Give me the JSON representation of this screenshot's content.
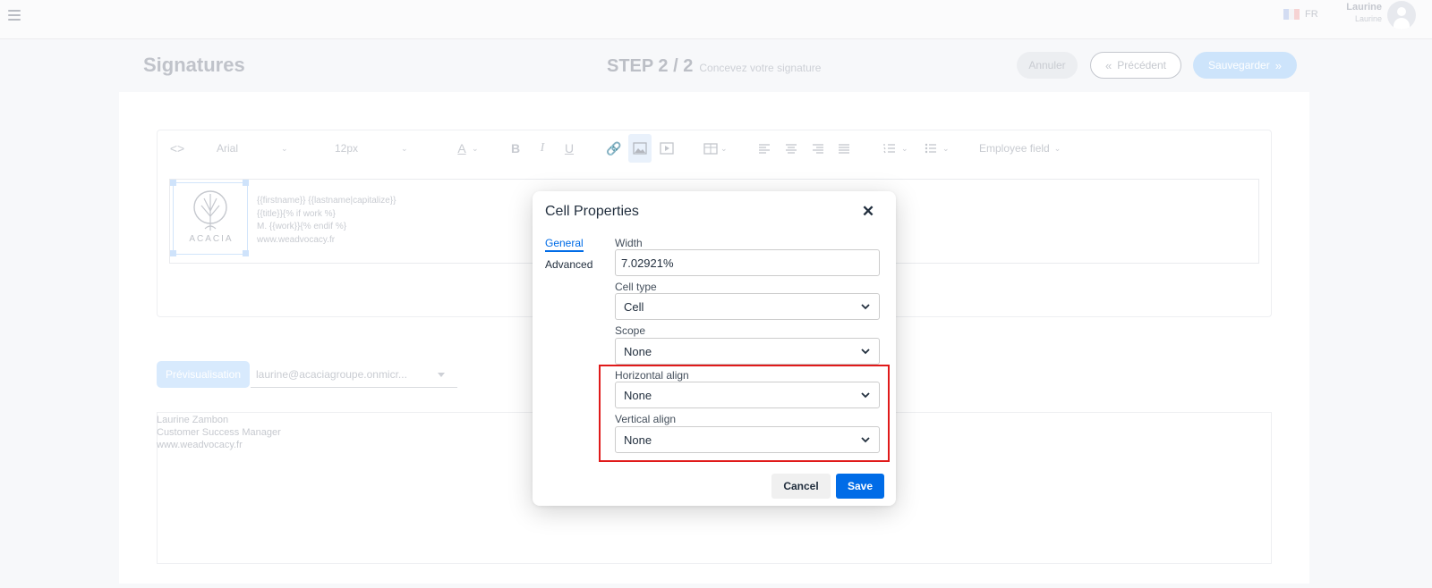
{
  "topbar": {
    "lang": "FR",
    "user_name": "Laurine",
    "user_sub": "Laurine"
  },
  "header": {
    "title": "Signatures",
    "step": "STEP 2 / 2",
    "step_desc": "Concevez votre signature",
    "cancel_label": "Annuler",
    "prev_label": "Précédent",
    "save_label": "Sauvegarder"
  },
  "toolbar": {
    "font": "Arial",
    "size": "12px",
    "employee_field": "Employee field"
  },
  "signature": {
    "logo_text": "ACACIA",
    "lines": [
      "{{firstname}} {{lastname|capitalize}}",
      "{{title}}{% if work %}",
      "M. {{work}}{% endif %}",
      "www.weadvocacy.fr"
    ]
  },
  "preview": {
    "button_label": "Prévisualisation",
    "email": "laurine@acaciagroupe.onmicr...",
    "lines": [
      "Laurine Zambon",
      "Customer Success Manager",
      "www.weadvocacy.fr"
    ]
  },
  "dialog": {
    "title": "Cell Properties",
    "tabs": [
      "General",
      "Advanced"
    ],
    "width_label": "Width",
    "width_value": "7.02921%",
    "cell_type_label": "Cell type",
    "cell_type_value": "Cell",
    "scope_label": "Scope",
    "scope_value": "None",
    "halign_label": "Horizontal align",
    "halign_value": "None",
    "valign_label": "Vertical align",
    "valign_value": "None",
    "cancel_label": "Cancel",
    "save_label": "Save"
  },
  "colors": {
    "accent": "#006ce7",
    "highlight": "#e01a1a"
  }
}
